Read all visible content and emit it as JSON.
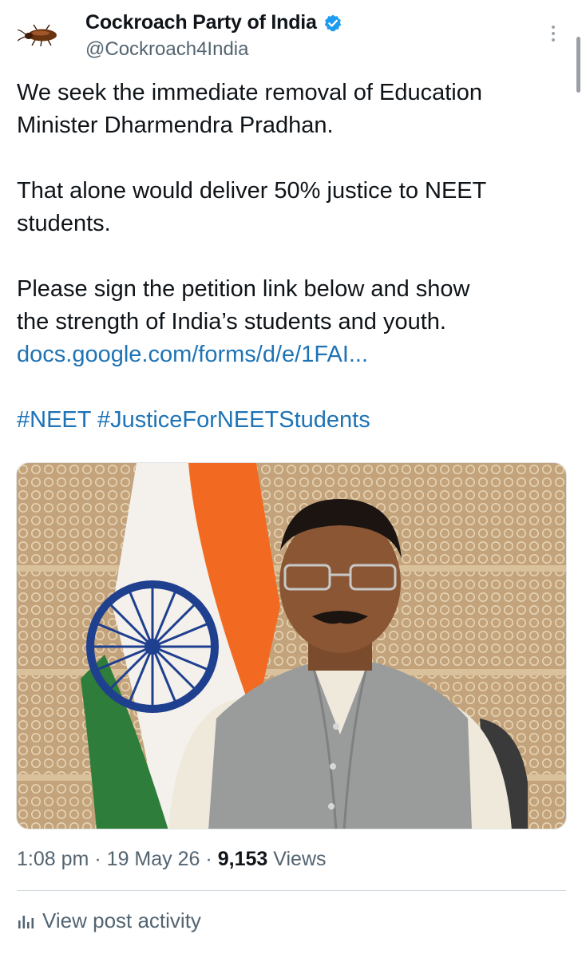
{
  "account": {
    "display_name": "Cockroach Party of India",
    "handle": "@Cockroach4India",
    "verified": true,
    "avatar_icon": "cockroach-icon"
  },
  "tweet": {
    "line1": "We seek the immediate removal of Education",
    "line2": "Minister Dharmendra Pradhan.",
    "line3": "That alone would deliver 50% justice to NEET",
    "line4": "students.",
    "line5": "Please sign the petition link below and show",
    "line6": "the strength of India’s students and youth.",
    "link": "docs.google.com/forms/d/e/1FAI...",
    "hashtag1": "#NEET",
    "hashtag2": "#JusticeForNEETStudents"
  },
  "meta": {
    "time": "1:08 pm",
    "sep1": "·",
    "date": "19 May 26",
    "sep2": "·",
    "views_count": "9,153",
    "views_label": "Views"
  },
  "actions": {
    "view_activity": "View post activity",
    "activity_icon": "bar-chart-icon",
    "more_icon": "more-vertical-icon"
  },
  "colors": {
    "link": "#1d73b6",
    "verified": "#1d9bf0",
    "secondary_text": "#536471",
    "flag_saffron": "#f26a21",
    "flag_green": "#2e7d3a",
    "chakra": "#1f3f8f"
  }
}
